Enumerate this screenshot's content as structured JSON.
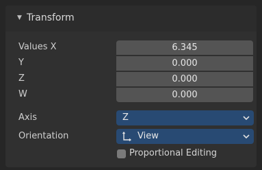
{
  "panel": {
    "title": "Transform",
    "expanded": true
  },
  "fields": {
    "values_x": {
      "label": "Values X",
      "value": "6.345"
    },
    "y": {
      "label": "Y",
      "value": "0.000"
    },
    "z": {
      "label": "Z",
      "value": "0.000"
    },
    "w": {
      "label": "W",
      "value": "0.000"
    }
  },
  "axis": {
    "label": "Axis",
    "value": "Z"
  },
  "orientation": {
    "label": "Orientation",
    "value": "View",
    "icon": "orientation-axes-icon"
  },
  "proportional_editing": {
    "label": "Proportional Editing",
    "checked": false
  },
  "colors": {
    "panel_bg": "#303030",
    "field_bg": "#545454",
    "dropdown_bg": "#284a73",
    "checkbox_bg": "#7a7a7a"
  }
}
